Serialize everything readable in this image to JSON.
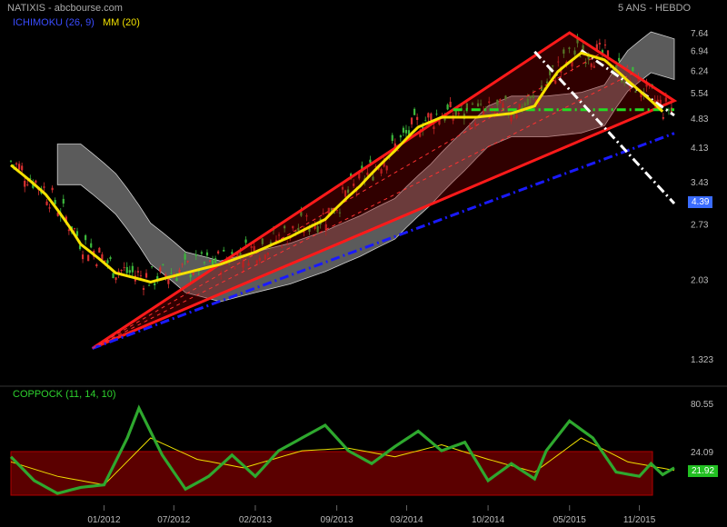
{
  "header": {
    "title": "NATIXIS - abcbourse.com",
    "period": "5 ANS - HEBDO",
    "ichimoku_label": "ICHIMOKU (26, 9)",
    "mm_label": "MM (20)",
    "coppock_label": "COPPOCK (11, 14, 10)"
  },
  "colors": {
    "background": "#000000",
    "candle_up": "#3cb83c",
    "candle_down": "#d83030",
    "mm": "#f5e100",
    "coppock": "#2ea82e",
    "ichimoku": "#3a4cff",
    "triangle": "#ff1a1a",
    "support": "#1a1aff",
    "horizontal": "#22dd22",
    "channel": "#ffffff"
  },
  "price_badge": "4.39",
  "coppock_badge": "21.92",
  "chart_data": [
    {
      "type": "line",
      "title": "NATIXIS - abcbourse.com",
      "scale": "log",
      "ylim": [
        1.323,
        7.64
      ],
      "y_ticks": [
        "7.64",
        "6.94",
        "6.24",
        "5.54",
        "4.83",
        "4.13",
        "3.43",
        "2.73",
        "2.03",
        "1.323"
      ],
      "x_ticks": [
        "01/2012",
        "07/2012",
        "02/2013",
        "09/2013",
        "03/2014",
        "10/2014",
        "05/2015",
        "11/2015"
      ],
      "x_range": [
        "2011-05",
        "2016-02"
      ],
      "last_price": 4.39,
      "series": [
        {
          "name": "MM (20)",
          "points": [
            [
              "2011-05",
              3.75
            ],
            [
              "2011-08",
              3.2
            ],
            [
              "2011-11",
              2.45
            ],
            [
              "2012-02",
              2.1
            ],
            [
              "2012-05",
              2.0
            ],
            [
              "2012-08",
              2.1
            ],
            [
              "2012-11",
              2.2
            ],
            [
              "2013-02",
              2.35
            ],
            [
              "2013-05",
              2.55
            ],
            [
              "2013-08",
              2.8
            ],
            [
              "2013-11",
              3.35
            ],
            [
              "2014-02",
              4.05
            ],
            [
              "2014-04",
              4.6
            ],
            [
              "2014-06",
              4.85
            ],
            [
              "2014-09",
              4.85
            ],
            [
              "2014-12",
              4.95
            ],
            [
              "2015-02",
              5.15
            ],
            [
              "2015-04",
              6.2
            ],
            [
              "2015-06",
              6.85
            ],
            [
              "2015-08",
              6.6
            ],
            [
              "2015-10",
              5.9
            ],
            [
              "2015-12",
              5.3
            ],
            [
              "2016-01",
              5.0
            ]
          ]
        }
      ],
      "drawings": [
        {
          "kind": "rising-wedge",
          "points": [
            [
              "2011-12",
              1.4
            ],
            [
              "2015-05",
              7.64
            ],
            [
              "2016-02",
              5.3
            ],
            [
              "2011-12",
              1.4
            ]
          ]
        },
        {
          "kind": "support-line",
          "points": [
            [
              "2011-12",
              1.4
            ],
            [
              "2016-02",
              4.45
            ]
          ]
        },
        {
          "kind": "horizontal-level",
          "value": 5.05,
          "points": [
            [
              "2014-07",
              5.05
            ],
            [
              "2016-02",
              5.05
            ]
          ]
        },
        {
          "kind": "descending-channel",
          "points": [
            [
              "2015-02",
              6.9
            ],
            [
              "2016-02",
              3.05
            ]
          ]
        },
        {
          "kind": "descending-channel",
          "points": [
            [
              "2015-06",
              6.95
            ],
            [
              "2016-02",
              4.9
            ]
          ]
        }
      ]
    },
    {
      "type": "line",
      "title": "COPPOCK (11, 14, 10)",
      "ylim": [
        -25,
        80.55
      ],
      "y_ticks": [
        "80.55",
        "24.09"
      ],
      "last_value": 21.92,
      "series": [
        {
          "name": "COPPOCK (11, 14, 10)",
          "points": [
            [
              "2011-05",
              18
            ],
            [
              "2011-07",
              -10
            ],
            [
              "2011-09",
              -25
            ],
            [
              "2011-11",
              -18
            ],
            [
              "2012-01",
              -15
            ],
            [
              "2012-03",
              40
            ],
            [
              "2012-04",
              75
            ],
            [
              "2012-06",
              20
            ],
            [
              "2012-08",
              -20
            ],
            [
              "2012-10",
              -5
            ],
            [
              "2012-12",
              20
            ],
            [
              "2013-02",
              -5
            ],
            [
              "2013-04",
              25
            ],
            [
              "2013-06",
              40
            ],
            [
              "2013-08",
              55
            ],
            [
              "2013-10",
              25
            ],
            [
              "2013-12",
              10
            ],
            [
              "2014-02",
              30
            ],
            [
              "2014-04",
              48
            ],
            [
              "2014-06",
              25
            ],
            [
              "2014-08",
              35
            ],
            [
              "2014-10",
              -10
            ],
            [
              "2014-12",
              10
            ],
            [
              "2015-02",
              -8
            ],
            [
              "2015-03",
              25
            ],
            [
              "2015-05",
              60
            ],
            [
              "2015-07",
              40
            ],
            [
              "2015-09",
              0
            ],
            [
              "2015-11",
              -5
            ],
            [
              "2015-12",
              10
            ],
            [
              "2016-01",
              -3
            ],
            [
              "2016-02",
              5
            ]
          ]
        },
        {
          "name": "signal",
          "points": [
            [
              "2011-05",
              12
            ],
            [
              "2011-09",
              -5
            ],
            [
              "2012-01",
              -15
            ],
            [
              "2012-05",
              40
            ],
            [
              "2012-09",
              15
            ],
            [
              "2013-01",
              5
            ],
            [
              "2013-06",
              25
            ],
            [
              "2013-10",
              28
            ],
            [
              "2014-02",
              18
            ],
            [
              "2014-06",
              32
            ],
            [
              "2014-10",
              15
            ],
            [
              "2015-02",
              0
            ],
            [
              "2015-06",
              40
            ],
            [
              "2015-10",
              12
            ],
            [
              "2016-02",
              2
            ]
          ]
        }
      ]
    }
  ]
}
